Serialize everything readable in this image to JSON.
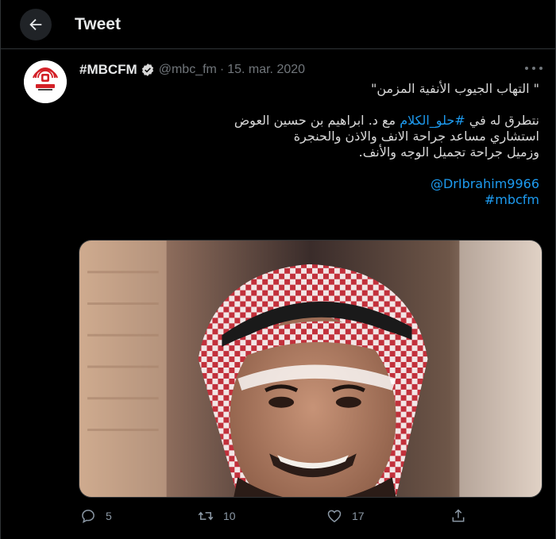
{
  "header": {
    "title": "Tweet"
  },
  "tweet": {
    "display_name": "#MBCFM",
    "handle": "@mbc_fm",
    "separator": "·",
    "date": "15. mar. 2020",
    "body": {
      "title_line": "\" التهاب الجيوب الأنفية المزمن\"",
      "line1_prefix": "نتطرق له في ",
      "line1_hashtag": "#حلو_الكلام",
      "line1_suffix": " مع د. ابراهيم بن حسين العوض",
      "line2": "استشاري مساعد جراحة الانف والاذن والحنجرة",
      "line3": "وزميل جراحة تجميل الوجه والأنف.",
      "mention": "@DrIbrahim9966",
      "hashtag": "#mbcfm"
    },
    "actions": {
      "replies": "5",
      "retweets": "10",
      "likes": "17"
    }
  },
  "colors": {
    "background": "#000000",
    "accent": "#1d9bf0",
    "muted": "#71767b",
    "text": "#d9d9d9",
    "brand_red": "#d32027"
  },
  "icons": {
    "back": "arrow-left-icon",
    "verified": "verified-badge-icon",
    "more": "more-horizontal-icon",
    "reply": "reply-icon",
    "retweet": "retweet-icon",
    "like": "heart-icon",
    "share": "share-icon"
  }
}
